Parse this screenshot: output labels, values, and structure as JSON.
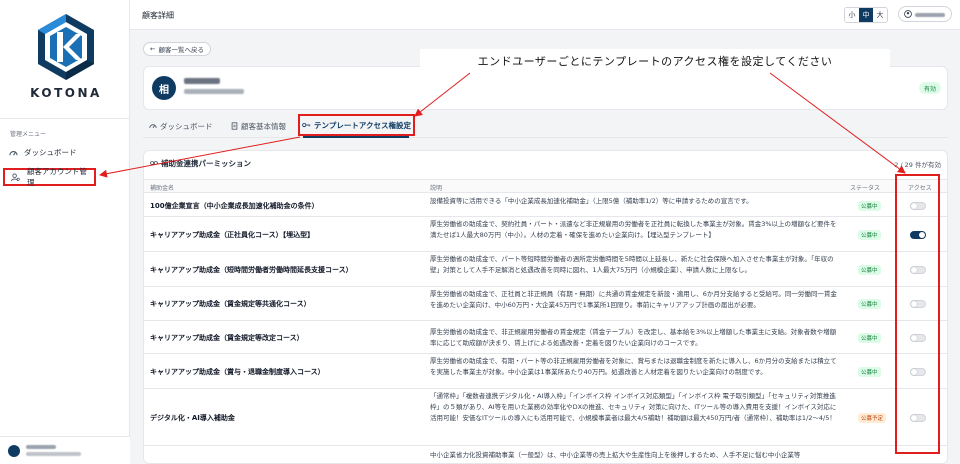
{
  "sidebar": {
    "logo_text": "KOTONA",
    "menu_heading": "管理メニュー",
    "items": [
      {
        "label": "ダッシュボード",
        "icon": "dashboard-icon"
      },
      {
        "label": "顧客アカウント管理",
        "icon": "user-manage-icon"
      }
    ]
  },
  "header": {
    "title": "顧客詳細",
    "font_sizes": [
      "小",
      "中",
      "大"
    ],
    "active_size": "中"
  },
  "back_label": "顧客一覧へ戻る",
  "callout_text": "エンドユーザーごとにテンプレートのアクセス権を設定してください",
  "customer": {
    "avatar_initial": "相",
    "status": "有効"
  },
  "tabs": [
    {
      "label": "ダッシュボード",
      "icon": "gauge-icon"
    },
    {
      "label": "顧客基本情報",
      "icon": "document-icon"
    },
    {
      "label": "テンプレートアクセス権設定",
      "icon": "key-icon",
      "active": true
    }
  ],
  "permission": {
    "title": "補助金連携パーミッション",
    "count": "2 / 29 件が有効",
    "columns": {
      "name": "補助金名",
      "desc": "説明",
      "status": "ステータス",
      "access": "アクセス"
    },
    "rows": [
      {
        "name": "100億企業宣言（中小企業成長加速化補助金の条件）",
        "desc": "設備投資等に活用できる「中小企業成長加速化補助金」（上限5億（補助率1/2）等に申請するための宣言です。",
        "status": "公募中",
        "status_type": "green",
        "access": false
      },
      {
        "name": "キャリアアップ助成金（正社員化コース）【埋込型】",
        "desc": "厚生労働省の助成金で、契約社員・パート・派遣など非正規雇用の労働者を正社員に転換した事業主が対象。賃金3%以上の増額など要件を満たせば1人最大80万円（中小）。人材の定着・確保を進めたい企業向け。【埋込型テンプレート】",
        "status": "公募中",
        "status_type": "green",
        "access": true
      },
      {
        "name": "キャリアアップ助成金（短時間労働者労働時間延長支援コース）",
        "desc": "厚生労働省の助成金で、パート等短時間労働者の週所定労働時間を5時間以上延長し、新たに社会保険へ加入させた事業主が対象。「年収の壁」対策として人手不足解消と処遇改善を同時に図れ、1人最大75万円（小規模企業）、申請人数に上限なし。",
        "status": "公募中",
        "status_type": "green",
        "access": false
      },
      {
        "name": "キャリアアップ助成金（賃金規定等共通化コース）",
        "desc": "厚生労働省の助成金で、正社員と非正規員（有期・無期）に共通の賃金規定を新設・適用し、6か月分支給すると受給可。同一労働同一賃金を進めたい企業向け、中小60万円・大企業45万円で1事業所1回限り。事前にキャリアアップ計画の届出が必要。",
        "status": "公募中",
        "status_type": "green",
        "access": false
      },
      {
        "name": "キャリアアップ助成金（賃金規定等改定コース）",
        "desc": "厚生労働省の助成金で、非正規雇用労働者の賃金規定（賃金テーブル）を改定し、基本給を3%以上増額した事業主に支給。対象者数や増額率に応じて助成額が決まり、賃上げによる処遇改善・定着を図りたい企業向けのコースです。",
        "status": "公募中",
        "status_type": "green",
        "access": false
      },
      {
        "name": "キャリアアップ助成金（賞与・退職金制度導入コース）",
        "desc": "厚生労働省の助成金で、有期・パート等の非正規雇用労働者を対象に、賞与または退職金制度を新たに導入し、6か月分の支給または積立てを実施した事業主が対象。中小企業は1事業所あたり40万円。処遇改善と人材定着を図りたい企業向けの制度です。",
        "status": "公募中",
        "status_type": "green",
        "access": false
      },
      {
        "name": "デジタル化・AI導入補助金",
        "desc": "「通常枠」「複数者連携デジタル化・AI導入枠」「インボイス枠 インボイス対応類型」「インボイス枠 電子取引類型」「セキュリティ対策推進枠」の５類があり、AI等を用いた業務の効率化やDXの推進、セキュリティ 対策に向けた、ITツール等の導入費用を支援！インボイス対応に活用可能！安価なITツールの導入にも活用可能で、小規模事業者は最大4/5補助！補助額は最大450万円/者（通常枠）、補助率は1/2〜4/5！",
        "status": "公募予定",
        "status_type": "orange",
        "access": false
      },
      {
        "name": "",
        "desc": "中小企業省力化投資補助事業（一般型）は、中小企業等の売上拡大や生産性向上を後押しするため、人手不足に悩む中小企業等",
        "status": "",
        "status_type": "green",
        "access": false
      }
    ]
  },
  "colors": {
    "brand": "#0f3b63",
    "highlight": "#e11d1d",
    "green_badge": "#15803d",
    "orange_badge": "#c2410c"
  }
}
